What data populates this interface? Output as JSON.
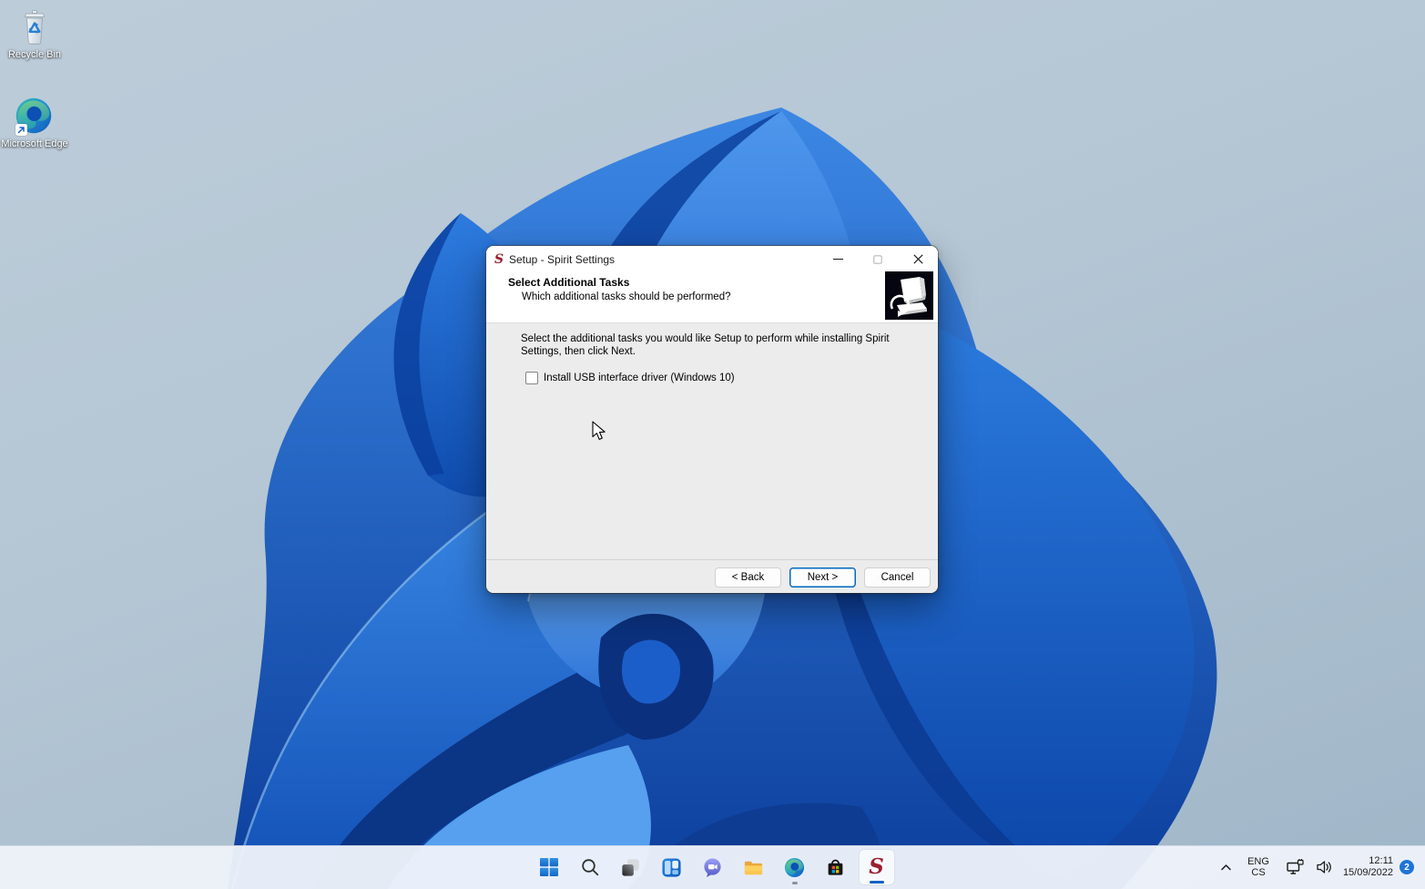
{
  "desktop_icons": [
    {
      "id": "recycle-bin",
      "label": "Recycle Bin"
    },
    {
      "id": "microsoft-edge",
      "label": "Microsoft Edge"
    }
  ],
  "window": {
    "title": "Setup - Spirit Settings",
    "header": {
      "title": "Select Additional Tasks",
      "subtitle": "Which additional tasks should be performed?"
    },
    "body": {
      "instruction": "Select the additional tasks you would like Setup to perform while installing Spirit Settings, then click Next.",
      "tasks": [
        {
          "label": "Install USB interface driver (Windows 10)",
          "checked": false
        }
      ]
    },
    "buttons": [
      {
        "id": "back",
        "label": "< Back",
        "default": false
      },
      {
        "id": "next",
        "label": "Next >",
        "default": true
      },
      {
        "id": "cancel",
        "label": "Cancel",
        "default": false
      }
    ],
    "controls": [
      "minimize",
      "maximize",
      "close"
    ]
  },
  "taskbar": {
    "items": [
      {
        "id": "start",
        "name": "Start"
      },
      {
        "id": "search",
        "name": "Search"
      },
      {
        "id": "task-view",
        "name": "Task View"
      },
      {
        "id": "widgets",
        "name": "Widgets"
      },
      {
        "id": "chat",
        "name": "Chat"
      },
      {
        "id": "file-explorer",
        "name": "File Explorer"
      },
      {
        "id": "edge",
        "name": "Microsoft Edge",
        "running": true
      },
      {
        "id": "store",
        "name": "Microsoft Store"
      },
      {
        "id": "spirit-setup",
        "name": "Spirit Settings Setup",
        "active": true
      }
    ],
    "tray": {
      "language": "ENG",
      "keyboard_layout": "CS",
      "time": "12:11",
      "date": "15/09/2022",
      "notification_count": "2"
    }
  },
  "colors": {
    "accent": "#0067c0",
    "badge": "#1e74d7",
    "dialog_body": "#ececec",
    "taskbar_bg": "#eef3fa",
    "spirit_red": "#9b1f31"
  }
}
